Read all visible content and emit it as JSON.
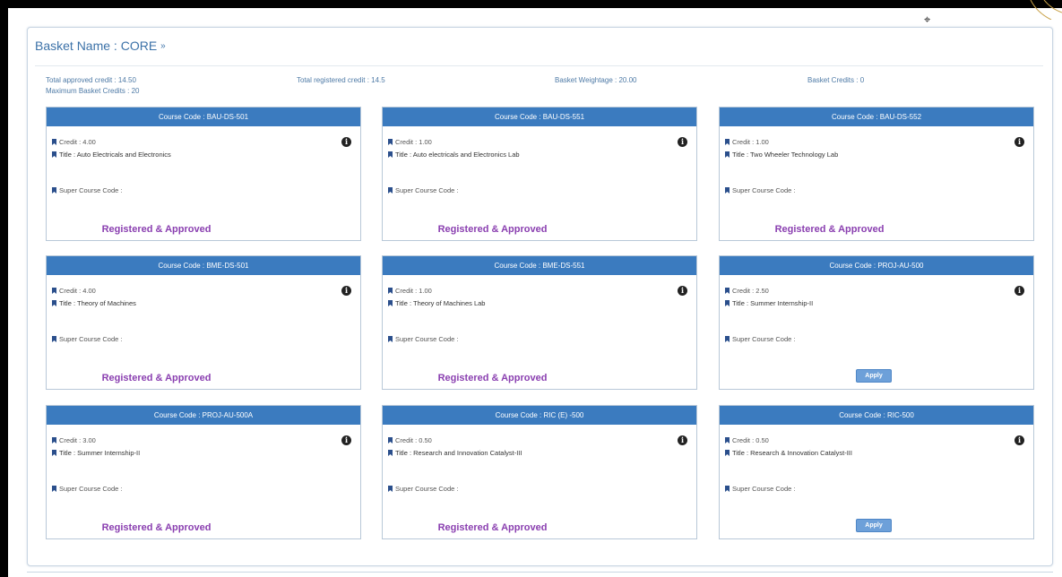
{
  "basket": {
    "title": "Basket Name : CORE",
    "chevron": "»"
  },
  "stats": {
    "total_approved": "Total approved credit : 14.50",
    "max_basket": "Maximum Basket Credits : 20",
    "total_registered": "Total registered credit : 14.5",
    "weightage": "Basket Weightage : 20.00",
    "basket_credits": "Basket Credits : 0"
  },
  "labels": {
    "super": "Super Course Code :"
  },
  "courses": [
    {
      "header": "Course Code : BAU-DS-501",
      "credit": "Credit : 4.00",
      "title": "Title : Auto Electricals and Electronics",
      "status": "Registered & Approved"
    },
    {
      "header": "Course Code : BAU-DS-551",
      "credit": "Credit : 1.00",
      "title": "Title : Auto electricals and Electronics Lab",
      "status": "Registered & Approved"
    },
    {
      "header": "Course Code : BAU-DS-552",
      "credit": "Credit : 1.00",
      "title": "Title : Two Wheeler Technology Lab",
      "status": "Registered & Approved"
    },
    {
      "header": "Course Code : BME-DS-501",
      "credit": "Credit : 4.00",
      "title": "Title : Theory of Machines",
      "status": "Registered & Approved"
    },
    {
      "header": "Course Code : BME-DS-551",
      "credit": "Credit : 1.00",
      "title": "Title : Theory of Machines Lab",
      "status": "Registered & Approved"
    },
    {
      "header": "Course Code : PROJ-AU-500",
      "credit": "Credit : 2.50",
      "title": "Title : Summer Internship-II",
      "button": "Apply"
    },
    {
      "header": "Course Code : PROJ-AU-500A",
      "credit": "Credit : 3.00",
      "title": "Title : Summer Internship-II",
      "status": "Registered & Approved"
    },
    {
      "header": "Course Code : RIC (E) -500",
      "credit": "Credit : 0.50",
      "title": "Title : Research and Innovation Catalyst-III",
      "status": "Registered & Approved"
    },
    {
      "header": "Course Code : RIC-500",
      "credit": "Credit : 0.50",
      "title": "Title : Research & Innovation Catalyst-III",
      "button": "Apply"
    }
  ],
  "colors": {
    "header_blue": "#3b7bbf",
    "status_purple": "#8a3fb0",
    "title_blue": "#3c72a8"
  },
  "icons": [
    "bookmark-icon",
    "info-icon",
    "chevron-down-icon",
    "cursor-icon"
  ]
}
